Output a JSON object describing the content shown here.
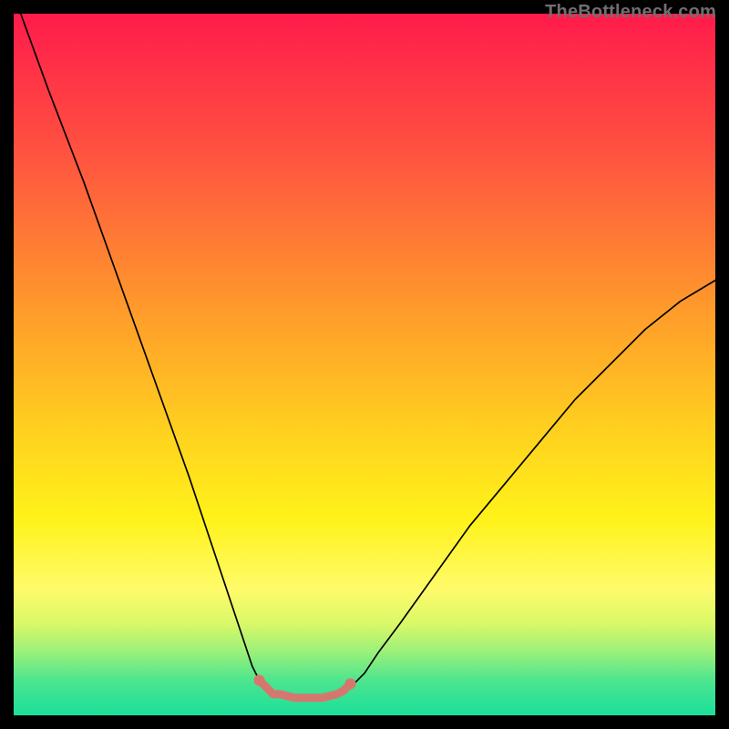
{
  "watermark": "TheBottleneck.com",
  "chart_data": {
    "type": "line",
    "title": "",
    "xlabel": "",
    "ylabel": "",
    "xlim": [
      0,
      100
    ],
    "ylim": [
      0,
      100
    ],
    "grid": false,
    "series": [
      {
        "name": "curve-left",
        "x": [
          1,
          5,
          10,
          15,
          20,
          25,
          28,
          30,
          32,
          34,
          35,
          36,
          37,
          38
        ],
        "y": [
          100,
          89,
          76,
          62,
          48,
          34,
          25,
          19,
          13,
          7,
          5,
          4,
          3,
          3
        ],
        "stroke": "#000000",
        "width": 1.7
      },
      {
        "name": "curve-right",
        "x": [
          46,
          47,
          48,
          50,
          52,
          55,
          60,
          65,
          70,
          75,
          80,
          85,
          90,
          95,
          100
        ],
        "y": [
          3,
          3,
          4,
          6,
          9,
          13,
          20,
          27,
          33,
          39,
          45,
          50,
          55,
          59,
          62
        ],
        "stroke": "#000000",
        "width": 1.7
      },
      {
        "name": "trough-highlight",
        "x": [
          35,
          36,
          37,
          38,
          40,
          42,
          44,
          46,
          47,
          48
        ],
        "y": [
          5,
          4,
          3,
          3,
          2.5,
          2.5,
          2.5,
          3,
          3.5,
          4.5
        ],
        "stroke": "#d6776f",
        "width": 9,
        "dots_x": [
          35,
          48
        ],
        "dots_y": [
          5,
          4.5
        ],
        "dot_r": 6
      }
    ],
    "gradient_stops": [
      {
        "offset": 0.0,
        "color": "#ff1b4b"
      },
      {
        "offset": 0.2,
        "color": "#ff5340"
      },
      {
        "offset": 0.42,
        "color": "#ff9a2b"
      },
      {
        "offset": 0.6,
        "color": "#ffd21f"
      },
      {
        "offset": 0.72,
        "color": "#fff21a"
      },
      {
        "offset": 0.82,
        "color": "#fffb6a"
      },
      {
        "offset": 0.87,
        "color": "#d9f868"
      },
      {
        "offset": 0.91,
        "color": "#9af07a"
      },
      {
        "offset": 0.95,
        "color": "#4de58e"
      },
      {
        "offset": 1.0,
        "color": "#1adf9a"
      }
    ]
  }
}
